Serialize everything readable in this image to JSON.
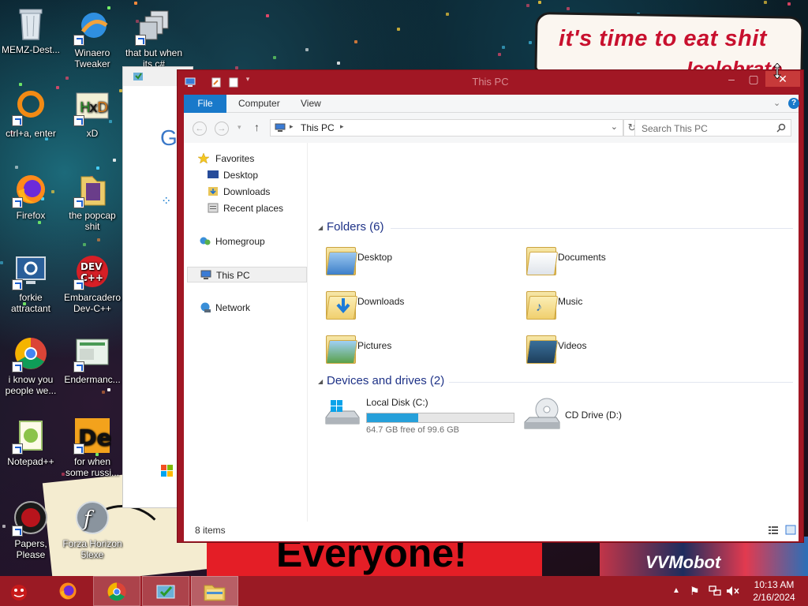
{
  "wallpaper": {
    "speech_line1": "it's time to eat shit",
    "speech_line2": "Icelebrate",
    "banner_text": "Everyone!",
    "right_text": "VVMobot"
  },
  "desktop_icons": [
    {
      "label": "MEMZ-Dest...",
      "icon": "recycle-bin-icon"
    },
    {
      "label": "Winaero Tweaker",
      "icon": "winaero-tweaker-icon"
    },
    {
      "label": "that but when its c#",
      "icon": "stacked-windows-icon"
    },
    {
      "label": "ctrl+a, enter",
      "icon": "orange-ring-icon"
    },
    {
      "label": "xD",
      "icon": "hxd-icon"
    },
    {
      "label": "Firefox",
      "icon": "firefox-icon"
    },
    {
      "label": "the popcap shit",
      "icon": "folder-icon"
    },
    {
      "label": "forkie attractant",
      "icon": "settings-monitor-icon"
    },
    {
      "label": "Embarcadero Dev-C++",
      "icon": "devcpp-icon"
    },
    {
      "label": "i know you people we...",
      "icon": "chrome-icon"
    },
    {
      "label": "Endermanc...",
      "icon": "screenshot-icon"
    },
    {
      "label": "Notepad++",
      "icon": "notepadpp-icon"
    },
    {
      "label": "for when some russi...",
      "icon": "de-icon"
    },
    {
      "label": "Papers, Please",
      "icon": "papers-please-icon"
    },
    {
      "label": "Forza Horizon 5lexe",
      "icon": "flash-icon"
    }
  ],
  "explorer": {
    "title": "This PC",
    "close_glyph": "✕",
    "ribbon_tabs": [
      "File",
      "Computer",
      "View"
    ],
    "address": "This PC",
    "search_placeholder": "Search This PC",
    "nav": {
      "favorites": "Favorites",
      "desktop": "Desktop",
      "downloads": "Downloads",
      "recent": "Recent places",
      "homegroup": "Homegroup",
      "this_pc": "This PC",
      "network": "Network"
    },
    "folders_header": "Folders (6)",
    "folders": [
      "Desktop",
      "Documents",
      "Downloads",
      "Music",
      "Pictures",
      "Videos"
    ],
    "devices_header": "Devices and drives (2)",
    "drives": [
      {
        "name": "Local Disk (C:)",
        "free": "64.7 GB free of 99.6 GB",
        "used_fraction": 0.35
      },
      {
        "name": "CD Drive (D:)"
      }
    ],
    "status": "8 items"
  },
  "taskbar": {
    "clock_time": "10:13 AM",
    "clock_date": "2/16/2024",
    "apps": [
      "memz-icon",
      "firefox-icon",
      "chrome-icon",
      "installer-icon",
      "file-explorer-icon"
    ]
  },
  "colors": {
    "accent": "#a11724",
    "taskbar": "#9a1a24",
    "file_tab": "#1979ca",
    "group_header": "#1e3287",
    "drive_bar": "#26a0da"
  }
}
